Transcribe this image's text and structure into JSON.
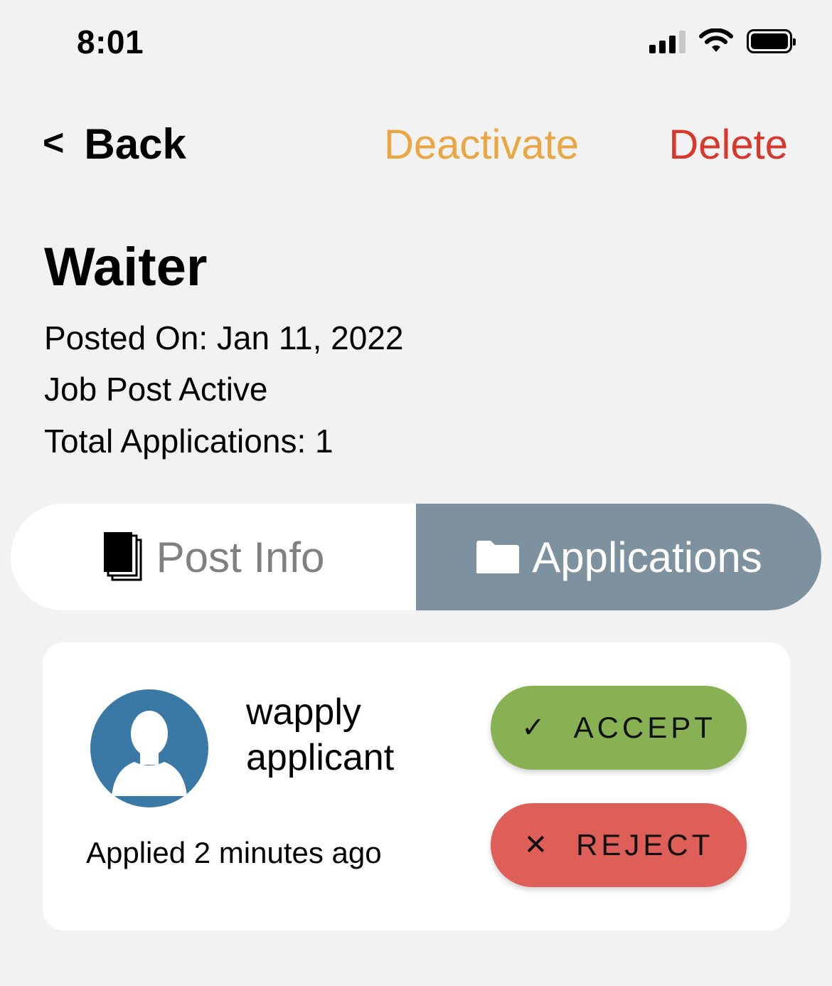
{
  "status_bar": {
    "time": "8:01",
    "icons": [
      "cellular-signal-icon",
      "wifi-icon",
      "battery-icon"
    ]
  },
  "nav": {
    "back_chevron": "<",
    "back_label": "Back",
    "deactivate_label": "Deactivate",
    "delete_label": "Delete",
    "colors": {
      "deactivate": "#eaa640",
      "delete": "#d8382c"
    }
  },
  "job": {
    "title": "Waiter",
    "posted_on": "Posted On: Jan 11, 2022",
    "status": "Job Post Active",
    "total_applications": "Total Applications: 1"
  },
  "tabs": {
    "selected": "applications",
    "post_info": {
      "label": "Post Info",
      "icon": "documents-icon"
    },
    "applications": {
      "label": "Applications",
      "icon": "folder-icon"
    },
    "colors": {
      "selected_bg": "#7d919e",
      "unselected_bg": "#ffffff",
      "unselected_text": "#808080"
    }
  },
  "application": {
    "name": "wapply applicant",
    "applied": "Applied 2 minutes ago",
    "avatar_icon": "user-avatar-icon",
    "accept": {
      "icon": "checkmark-icon",
      "glyph": "✓",
      "label": "ACCEPT",
      "color": "#87b152"
    },
    "reject": {
      "icon": "close-icon",
      "glyph": "✕",
      "label": "REJECT",
      "color": "#de5f58"
    }
  }
}
